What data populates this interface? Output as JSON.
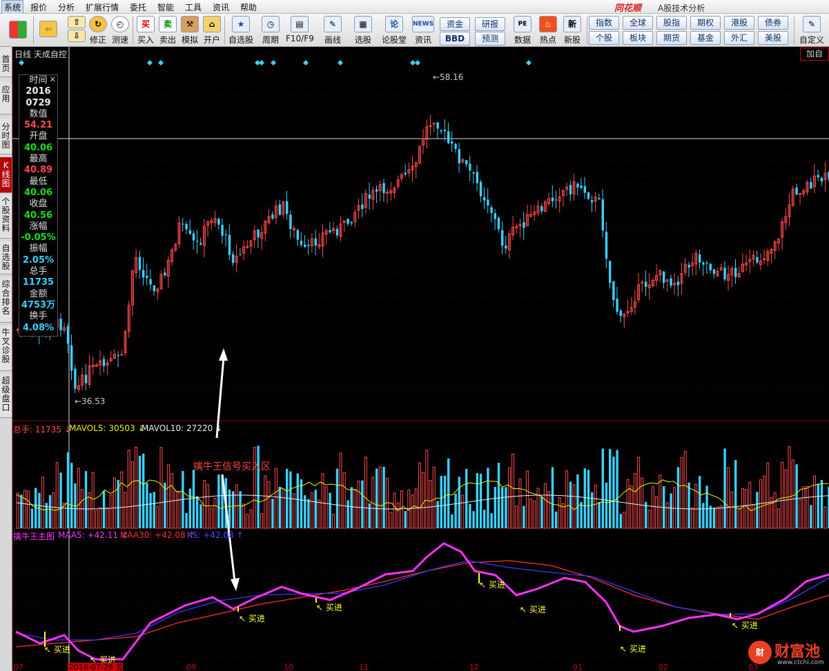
{
  "menu": [
    "系统",
    "报价",
    "分析",
    "扩展行情",
    "委托",
    "智能",
    "工具",
    "资讯",
    "帮助"
  ],
  "brand": "同花顺",
  "window_title": "A股技术分析",
  "toolbar": {
    "buttons": [
      "修正",
      "测速",
      "买入",
      "卖出",
      "模拟",
      "开户",
      "自选股",
      "周期",
      "F10/F9",
      "画线",
      "选股",
      "论股堂",
      "资讯",
      "数据",
      "热点",
      "新股"
    ],
    "icon_glyphs": {
      "buy": "买",
      "sell": "卖",
      "lun": "论",
      "news": "NEWS",
      "pe": "PE",
      "new": "新"
    },
    "quick_buttons": [
      "资金",
      "研报",
      "BBD",
      "预测"
    ],
    "markets": [
      "指数",
      "全球",
      "股指",
      "期权",
      "港股",
      "债券",
      "个股",
      "板块",
      "期货",
      "基金",
      "外汇",
      "美股"
    ],
    "customize": "自定义"
  },
  "sidebar": [
    "首页",
    "应用",
    "分时图",
    "K线图",
    "个股资料",
    "自选股",
    "综合排名",
    "牛叉诊股",
    "超级盘口"
  ],
  "chart": {
    "header": "日线  天成自控",
    "add_button": "加自",
    "high_label": "58.16",
    "low_label": "36.53"
  },
  "infobox": [
    {
      "label": "时间",
      "value": "2016\n0729",
      "color": "white"
    },
    {
      "label": "数值",
      "value": "54.21",
      "color": "red"
    },
    {
      "label": "开盘",
      "value": "40.06",
      "color": "green"
    },
    {
      "label": "最高",
      "value": "40.89",
      "color": "red"
    },
    {
      "label": "最低",
      "value": "40.06",
      "color": "green"
    },
    {
      "label": "收盘",
      "value": "40.56",
      "color": "green"
    },
    {
      "label": "涨幅",
      "value": "-0.05%",
      "color": "green"
    },
    {
      "label": "振幅",
      "value": "2.05%",
      "color": "cyan"
    },
    {
      "label": "总手",
      "value": "11735",
      "color": "cyan"
    },
    {
      "label": "金额",
      "value": "4753万",
      "color": "cyan"
    },
    {
      "label": "换手",
      "value": "4.08%",
      "color": "cyan"
    }
  ],
  "volume": {
    "total_label": "总手: 11735 ↓",
    "ma5_label": "MAVOL5: 30503 ↓",
    "ma10_label": "MAVOL10: 27220 ↓"
  },
  "indicator": {
    "name": "擒牛王主图",
    "maa5_label": "MAA5: +42.11 ↓",
    "maa30_label": "MAA30: +42.08 ↑",
    "ks_label": "KS: +42.08 ↑",
    "buy_label": "↖ 买进"
  },
  "annotation": "擒牛王信号买入区",
  "axis_dates": [
    "07",
    "2016-07-29 五",
    "09",
    "10",
    "11",
    "12",
    "01",
    "02",
    "03"
  ],
  "watermark": {
    "glyph": "财",
    "name": "财富池",
    "url": "www.ctchi.com"
  },
  "colors": {
    "up": "#ff4b4b",
    "down": "#3ad0ff",
    "maa5": "#ff33ff",
    "maa30": "#ff3030",
    "ks": "#3a3aff",
    "buy": "#ffff30"
  }
}
